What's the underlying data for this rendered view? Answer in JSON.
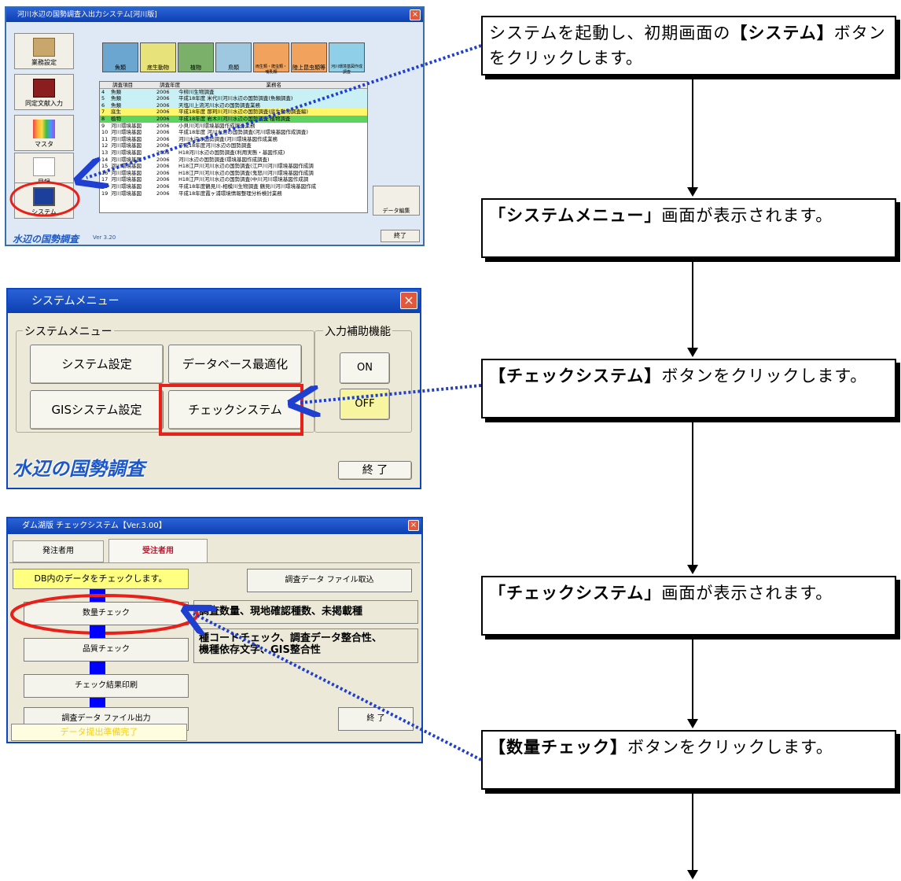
{
  "window1": {
    "title": "河川水辺の国勢調査入出力システム[河川版]",
    "sidebar": [
      "業務設定",
      "同定文献入力",
      "マスタ",
      "目録",
      "システム"
    ],
    "categories": [
      {
        "label": "魚類",
        "color": "#6aa6d0"
      },
      {
        "label": "底生動物",
        "color": "#e8e27a"
      },
      {
        "label": "植物",
        "color": "#7ab06a"
      },
      {
        "label": "鳥類",
        "color": "#9ec8e0"
      },
      {
        "label": "両生類・爬虫類・哺乳類",
        "color": "#f1a25c"
      },
      {
        "label": "陸上昆虫類等",
        "color": "#f1a25c"
      },
      {
        "label": "河川環境基図作成調査",
        "color": "#8fd0e8"
      }
    ],
    "grid_headers": [
      "調査項目",
      "調査年度",
      "業務名"
    ],
    "rows": [
      [
        "4",
        "魚類",
        "2006",
        "今柳川生物調査",
        "#c9f1f5"
      ],
      [
        "5",
        "魚類",
        "2006",
        "平成18年度 米代川河川水辺の国勢調査(魚類調査)",
        "#c9f1f5"
      ],
      [
        "6",
        "魚類",
        "2006",
        "天塩川上流河川水辺の国勢調査業務",
        "#c9f1f5"
      ],
      [
        "7",
        "底生",
        "2006",
        "平成18年度 那珂川河川水辺の国勢調査(底生動物調査編)",
        "#fff66b"
      ],
      [
        "8",
        "植物",
        "2006",
        "平成18年度 岩木川河川水辺の国勢調査 植物調査",
        "#5fd35f"
      ],
      [
        "9",
        "河川環境基図",
        "2006",
        "小貝川河川環境基図作成調査業務",
        "#ffffff"
      ],
      [
        "10",
        "河川環境基図",
        "2006",
        "平成18年度 河川水辺の国勢調査(河川環境基図作成調査)",
        "#ffffff"
      ],
      [
        "11",
        "河川環境基図",
        "2006",
        "河川水辺の国勢調査(河川環境基図作成業務",
        "#ffffff"
      ],
      [
        "12",
        "河川環境基図",
        "2006",
        "平成18年度河川水辺の国勢調査",
        "#ffffff"
      ],
      [
        "13",
        "河川環境基図",
        "2006",
        "H18河川水辺の国勢調査(利用実態・基図作成)",
        "#ffffff"
      ],
      [
        "14",
        "河川環境基図",
        "2006",
        "河川水辺の国勢調査(環境基図作成調査)",
        "#ffffff"
      ],
      [
        "15",
        "河川環境基図",
        "2006",
        "H18江戸川河川水辺の国勢調査(江戸川河川環境基図作成調",
        "#ffffff"
      ],
      [
        "16",
        "河川環境基図",
        "2006",
        "H18江戸川河川水辺の国勢調査(鬼怒川河川環境基図作成調",
        "#ffffff"
      ],
      [
        "17",
        "河川環境基図",
        "2006",
        "H18江戸川河川水辺の国勢調査(中川河川環境基図作成調",
        "#ffffff"
      ],
      [
        "18",
        "河川環境基図",
        "2006",
        "平成18年度鶴見川-相模川生物調査 鶴見川河川環境基図作成",
        "#ffffff"
      ],
      [
        "19",
        "河川環境基図",
        "2006",
        "平成18年度霞ヶ浦環境情報整理分析検討業務",
        "#ffffff"
      ]
    ],
    "data_edit": "データ編集",
    "logo": "水辺の国勢調査",
    "version": "Ver 3.20",
    "exit": "終了"
  },
  "window2": {
    "title": "システムメニュー",
    "group_label": "システムメニュー",
    "buttons": {
      "system_settings": "システム設定",
      "db_optimize": "データベース最適化",
      "gis_settings": "GISシステム設定",
      "check_system": "チェックシステム"
    },
    "assist_label": "入力補助機能",
    "on": "ON",
    "off": "OFF",
    "logo": "水辺の国勢調査",
    "exit": "終 了"
  },
  "window3": {
    "title": "ダム湖版 チェックシステム【Ver.3.00】",
    "tab_orderer": "発注者用",
    "tab_contractor": "受注者用",
    "db_check": "DB内のデータをチェックします。",
    "import": "調査データ ファイル取込",
    "quantity_check": "数量チェック",
    "quantity_desc": "調査数量、現地確認種数、未掲載種",
    "quality_check": "品質チェック",
    "quality_desc_1": "種コードチェック、調査データ整合性、",
    "quality_desc_2": "機種依存文字、GIS整合性",
    "print_results": "チェック結果印刷",
    "export": "調査データ ファイル出力",
    "status": "データ提出準備完了",
    "exit": "終 了"
  },
  "flow": {
    "step1_a": "システムを起動し、初期画面の",
    "step1_b": "【システム】",
    "step1_c": "ボタンをクリックします。",
    "step2_a": "「システムメニュー」",
    "step2_b": "画面が表示されます。",
    "step3_a": "【チェックシステム】",
    "step3_b": "ボタンをクリックします。",
    "step4_a": "「チェックシステム」",
    "step4_b": "画面が表示されます。",
    "step5_a": "【数量チェック】",
    "step5_b": "ボタンをクリックします。"
  }
}
